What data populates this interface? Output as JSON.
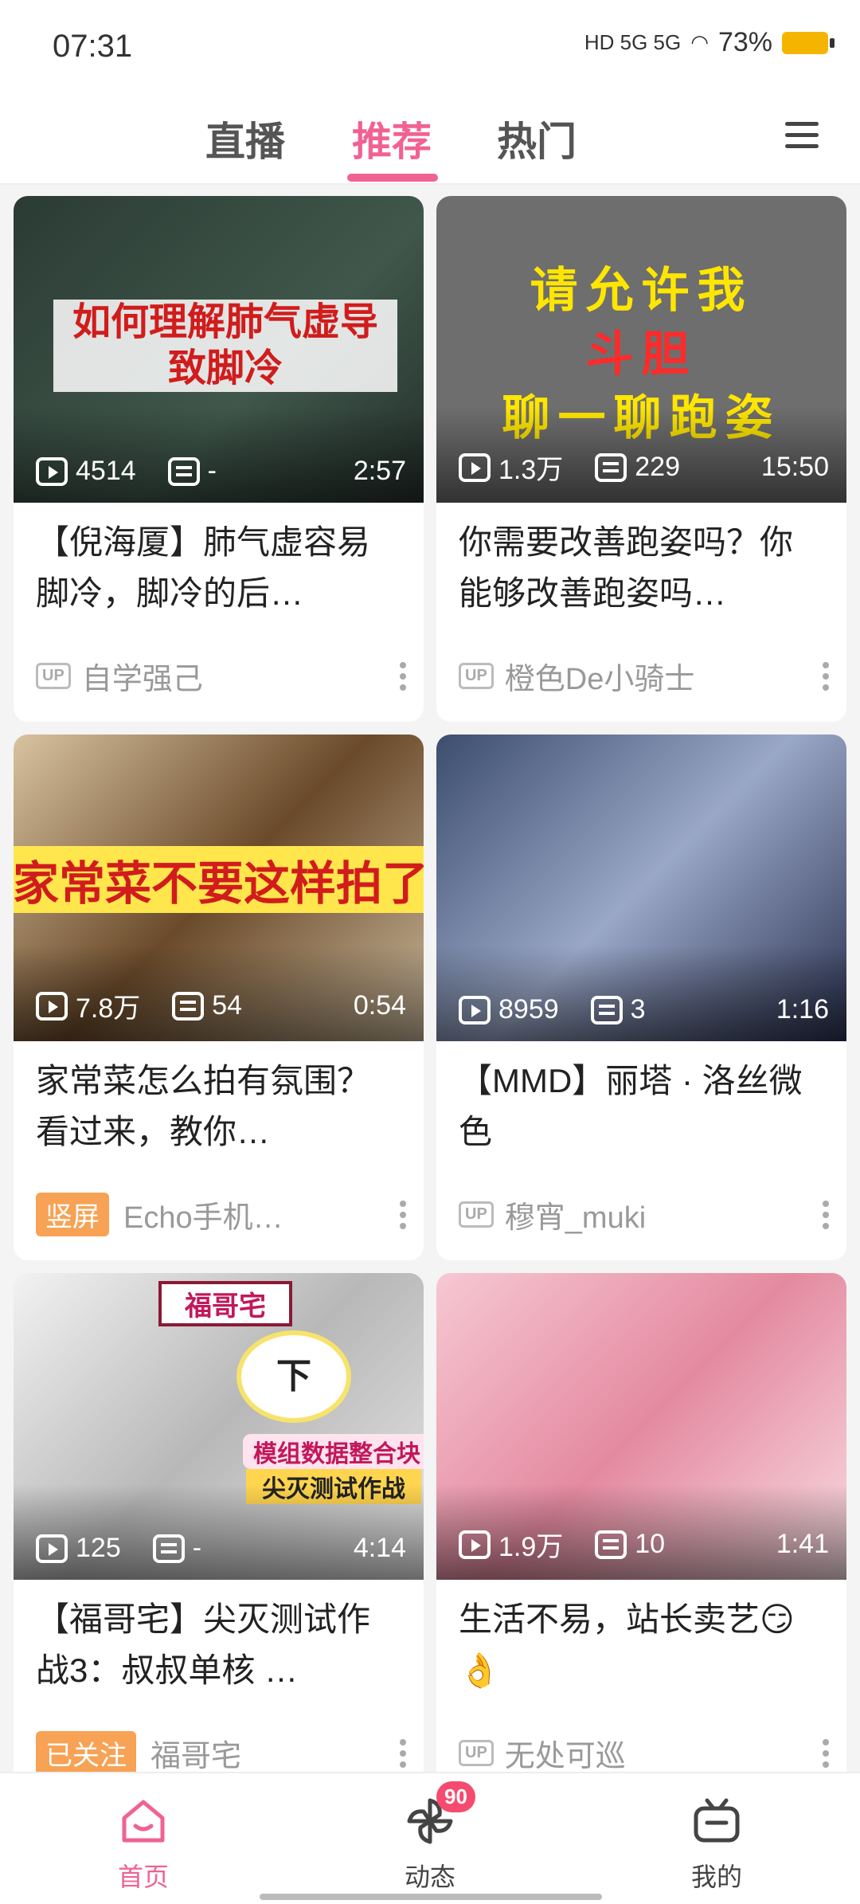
{
  "status": {
    "time": "07:31",
    "network": "HD 5G 5G",
    "battery": "73%"
  },
  "tabs": [
    {
      "label": "直播",
      "active": false
    },
    {
      "label": "推荐",
      "active": true
    },
    {
      "label": "热门",
      "active": false
    }
  ],
  "feed": [
    {
      "thumb_text": "如何理解肺气虚导致脚冷",
      "views": "4514",
      "danmaku": "-",
      "duration": "2:57",
      "title": "【倪海厦】肺气虚容易脚冷，脚冷的后…",
      "tag": "",
      "author": "自学强己",
      "up": "UP"
    },
    {
      "thumb_text_lines": [
        "请允许我",
        "斗胆",
        "聊一聊跑姿"
      ],
      "views": "1.3万",
      "danmaku": "229",
      "duration": "15:50",
      "title": "你需要改善跑姿吗？你能够改善跑姿吗…",
      "tag": "",
      "author": "橙色De小骑士",
      "up": "UP"
    },
    {
      "thumb_text": "家常菜不要这样拍了",
      "views": "7.8万",
      "danmaku": "54",
      "duration": "0:54",
      "title": "家常菜怎么拍有氛围？看过来，教你…",
      "tag": "竖屏",
      "author": "Echo手机…",
      "up": ""
    },
    {
      "views": "8959",
      "danmaku": "3",
      "duration": "1:16",
      "title": "【MMD】丽塔 · 洛丝微色",
      "tag": "",
      "author": "穆宵_muki",
      "up": "UP"
    },
    {
      "thumb_labels": [
        "福哥宅",
        "下",
        "模组数据整合块",
        "尖灭测试作战"
      ],
      "views": "125",
      "danmaku": "-",
      "duration": "4:14",
      "title": "【福哥宅】尖灭测试作战3：叔叔单核 …",
      "tag": "已关注",
      "author": "福哥宅",
      "up": ""
    },
    {
      "views": "1.9万",
      "danmaku": "10",
      "duration": "1:41",
      "title": "生活不易，站长卖艺😏👌",
      "tag": "",
      "author": "无处可巡",
      "up": "UP"
    }
  ],
  "bottom_nav": [
    {
      "label": "首页",
      "icon": "home-icon",
      "active": true
    },
    {
      "label": "动态",
      "icon": "pinwheel-icon",
      "badge": "90",
      "active": false
    },
    {
      "label": "我的",
      "icon": "tv-icon",
      "active": false
    }
  ],
  "accent": "#f06292"
}
